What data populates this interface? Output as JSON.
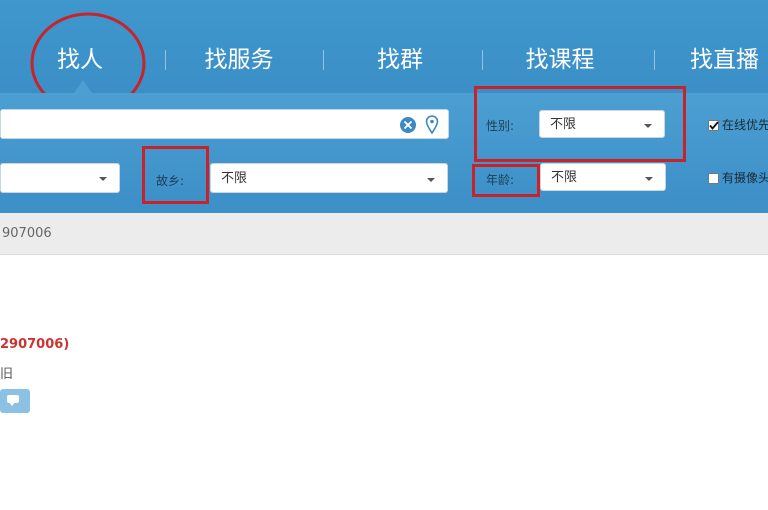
{
  "tabs": [
    {
      "label": "找人",
      "active": true
    },
    {
      "label": "找服务",
      "active": false
    },
    {
      "label": "找群",
      "active": false
    },
    {
      "label": "找课程",
      "active": false
    },
    {
      "label": "找直播",
      "active": false
    }
  ],
  "filters": {
    "gender_label": "性别:",
    "gender_value": "不限",
    "hometown_label": "故乡:",
    "hometown_value": "不限",
    "age_label": "年龄:",
    "age_value": "不限",
    "online_label": "在线优先",
    "online_checked": true,
    "has_photo_label": "有摄像头",
    "has_photo_checked": false
  },
  "info_strip": {
    "text": "907006"
  },
  "result": {
    "name": "2907006)",
    "sub": "旧"
  },
  "colors": {
    "tab_bar": "#3f97cd",
    "filter_panel": "#4b9fd2",
    "annotation_red": "#c8232b",
    "result_name": "#cc3333"
  },
  "icons": {
    "clear": "clear-circle-icon",
    "location": "location-pin-icon",
    "chat": "chat-bubble-icon"
  }
}
